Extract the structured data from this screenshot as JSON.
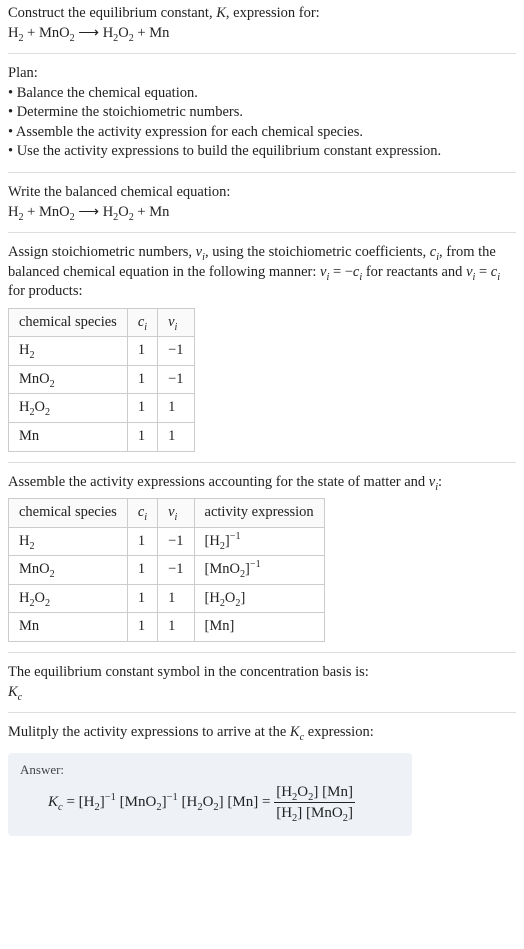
{
  "intro": {
    "prompt": "Construct the equilibrium constant, ",
    "Ksym": "K",
    "prompt_tail": ", expression for:",
    "equation_html": "H<sub>2</sub> + MnO<sub>2</sub>&nbsp;⟶&nbsp;H<sub>2</sub>O<sub>2</sub> + Mn"
  },
  "plan": {
    "heading": "Plan:",
    "bullets": [
      "Balance the chemical equation.",
      "Determine the stoichiometric numbers.",
      "Assemble the activity expression for each chemical species.",
      "Use the activity expressions to build the equilibrium constant expression."
    ]
  },
  "balanced": {
    "heading": "Write the balanced chemical equation:",
    "equation_html": "H<sub>2</sub> + MnO<sub>2</sub>&nbsp;⟶&nbsp;H<sub>2</sub>O<sub>2</sub> + Mn"
  },
  "stoich_text": {
    "part1": "Assign stoichiometric numbers, ",
    "nu_html": "<i>ν<sub>i</sub></i>",
    "part2": ", using the stoichiometric coefficients, ",
    "c_html": "<i>c<sub>i</sub></i>",
    "part3": ", from the balanced chemical equation in the following manner: ",
    "rel1_html": "<i>ν<sub>i</sub></i> = −<i>c<sub>i</sub></i>",
    "part4": " for reactants and ",
    "rel2_html": "<i>ν<sub>i</sub></i> = <i>c<sub>i</sub></i>",
    "part5": " for products:"
  },
  "table1": {
    "headers": [
      "chemical species",
      "c_i_html",
      "nu_i_html"
    ],
    "header_html": {
      "species": "chemical species",
      "ci": "<i>c<sub>i</sub></i>",
      "vi": "<i>ν<sub>i</sub></i>"
    },
    "rows": [
      {
        "sp": "H<sub>2</sub>",
        "c": "1",
        "v": "−1"
      },
      {
        "sp": "MnO<sub>2</sub>",
        "c": "1",
        "v": "−1"
      },
      {
        "sp": "H<sub>2</sub>O<sub>2</sub>",
        "c": "1",
        "v": "1"
      },
      {
        "sp": "Mn",
        "c": "1",
        "v": "1"
      }
    ]
  },
  "activity_heading_html": "Assemble the activity expressions accounting for the state of matter and <i>ν<sub>i</sub></i>:",
  "table2": {
    "header_html": {
      "species": "chemical species",
      "ci": "<i>c<sub>i</sub></i>",
      "vi": "<i>ν<sub>i</sub></i>",
      "act": "activity expression"
    },
    "rows": [
      {
        "sp": "H<sub>2</sub>",
        "c": "1",
        "v": "−1",
        "a": "[H<sub>2</sub>]<sup>−1</sup>"
      },
      {
        "sp": "MnO<sub>2</sub>",
        "c": "1",
        "v": "−1",
        "a": "[MnO<sub>2</sub>]<sup>−1</sup>"
      },
      {
        "sp": "H<sub>2</sub>O<sub>2</sub>",
        "c": "1",
        "v": "1",
        "a": "[H<sub>2</sub>O<sub>2</sub>]"
      },
      {
        "sp": "Mn",
        "c": "1",
        "v": "1",
        "a": "[Mn]"
      }
    ]
  },
  "kc_basis": {
    "line1": "The equilibrium constant symbol in the concentration basis is:",
    "sym_html": "<i>K<sub>c</sub></i>"
  },
  "final_heading_html": "Mulitply the activity expressions to arrive at the <i>K<sub>c</sub></i> expression:",
  "answer": {
    "label": "Answer:",
    "expr_lhs_html": "<i>K<sub>c</sub></i> = [H<sub>2</sub>]<sup>−1</sup> [MnO<sub>2</sub>]<sup>−1</sup> [H<sub>2</sub>O<sub>2</sub>] [Mn] = ",
    "frac_num_html": "[H<sub>2</sub>O<sub>2</sub>] [Mn]",
    "frac_den_html": "[H<sub>2</sub>] [MnO<sub>2</sub>]"
  },
  "chart_data": null
}
